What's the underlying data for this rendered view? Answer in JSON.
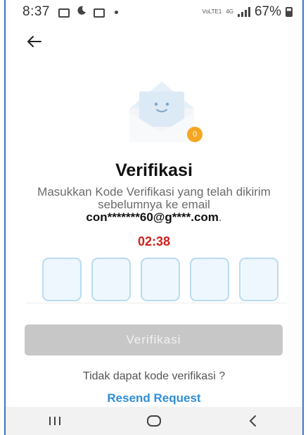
{
  "status_bar": {
    "time": "8:37",
    "network_top": "VoLTE1",
    "network_mid": "4G",
    "battery": "67%"
  },
  "icons": {
    "back": "arrow-left-icon",
    "envelope": "envelope-icon",
    "badge": "notification-badge",
    "recents": "recents-icon",
    "home": "home-icon",
    "nav_back": "chevron-left-icon"
  },
  "verification": {
    "badge_count": "0",
    "title": "Verifikasi",
    "description_line": "Masukkan Kode Verifikasi yang telah dikirim sebelumnya ke email",
    "email": "con*******60@g****.com",
    "email_suffix": ".",
    "timer": "02:38",
    "code_fields": [
      "",
      "",
      "",
      "",
      ""
    ],
    "verify_button": "Verifikasi",
    "no_code_text": "Tidak dapat kode verifikasi ?",
    "resend_link": "Resend Request"
  },
  "colors": {
    "frame_border": "#3a76c4",
    "timer": "#d0201c",
    "link": "#2f8fd6",
    "button_disabled": "#c7c7c7",
    "field_border": "#b9dbf0",
    "badge": "#f5a623"
  }
}
